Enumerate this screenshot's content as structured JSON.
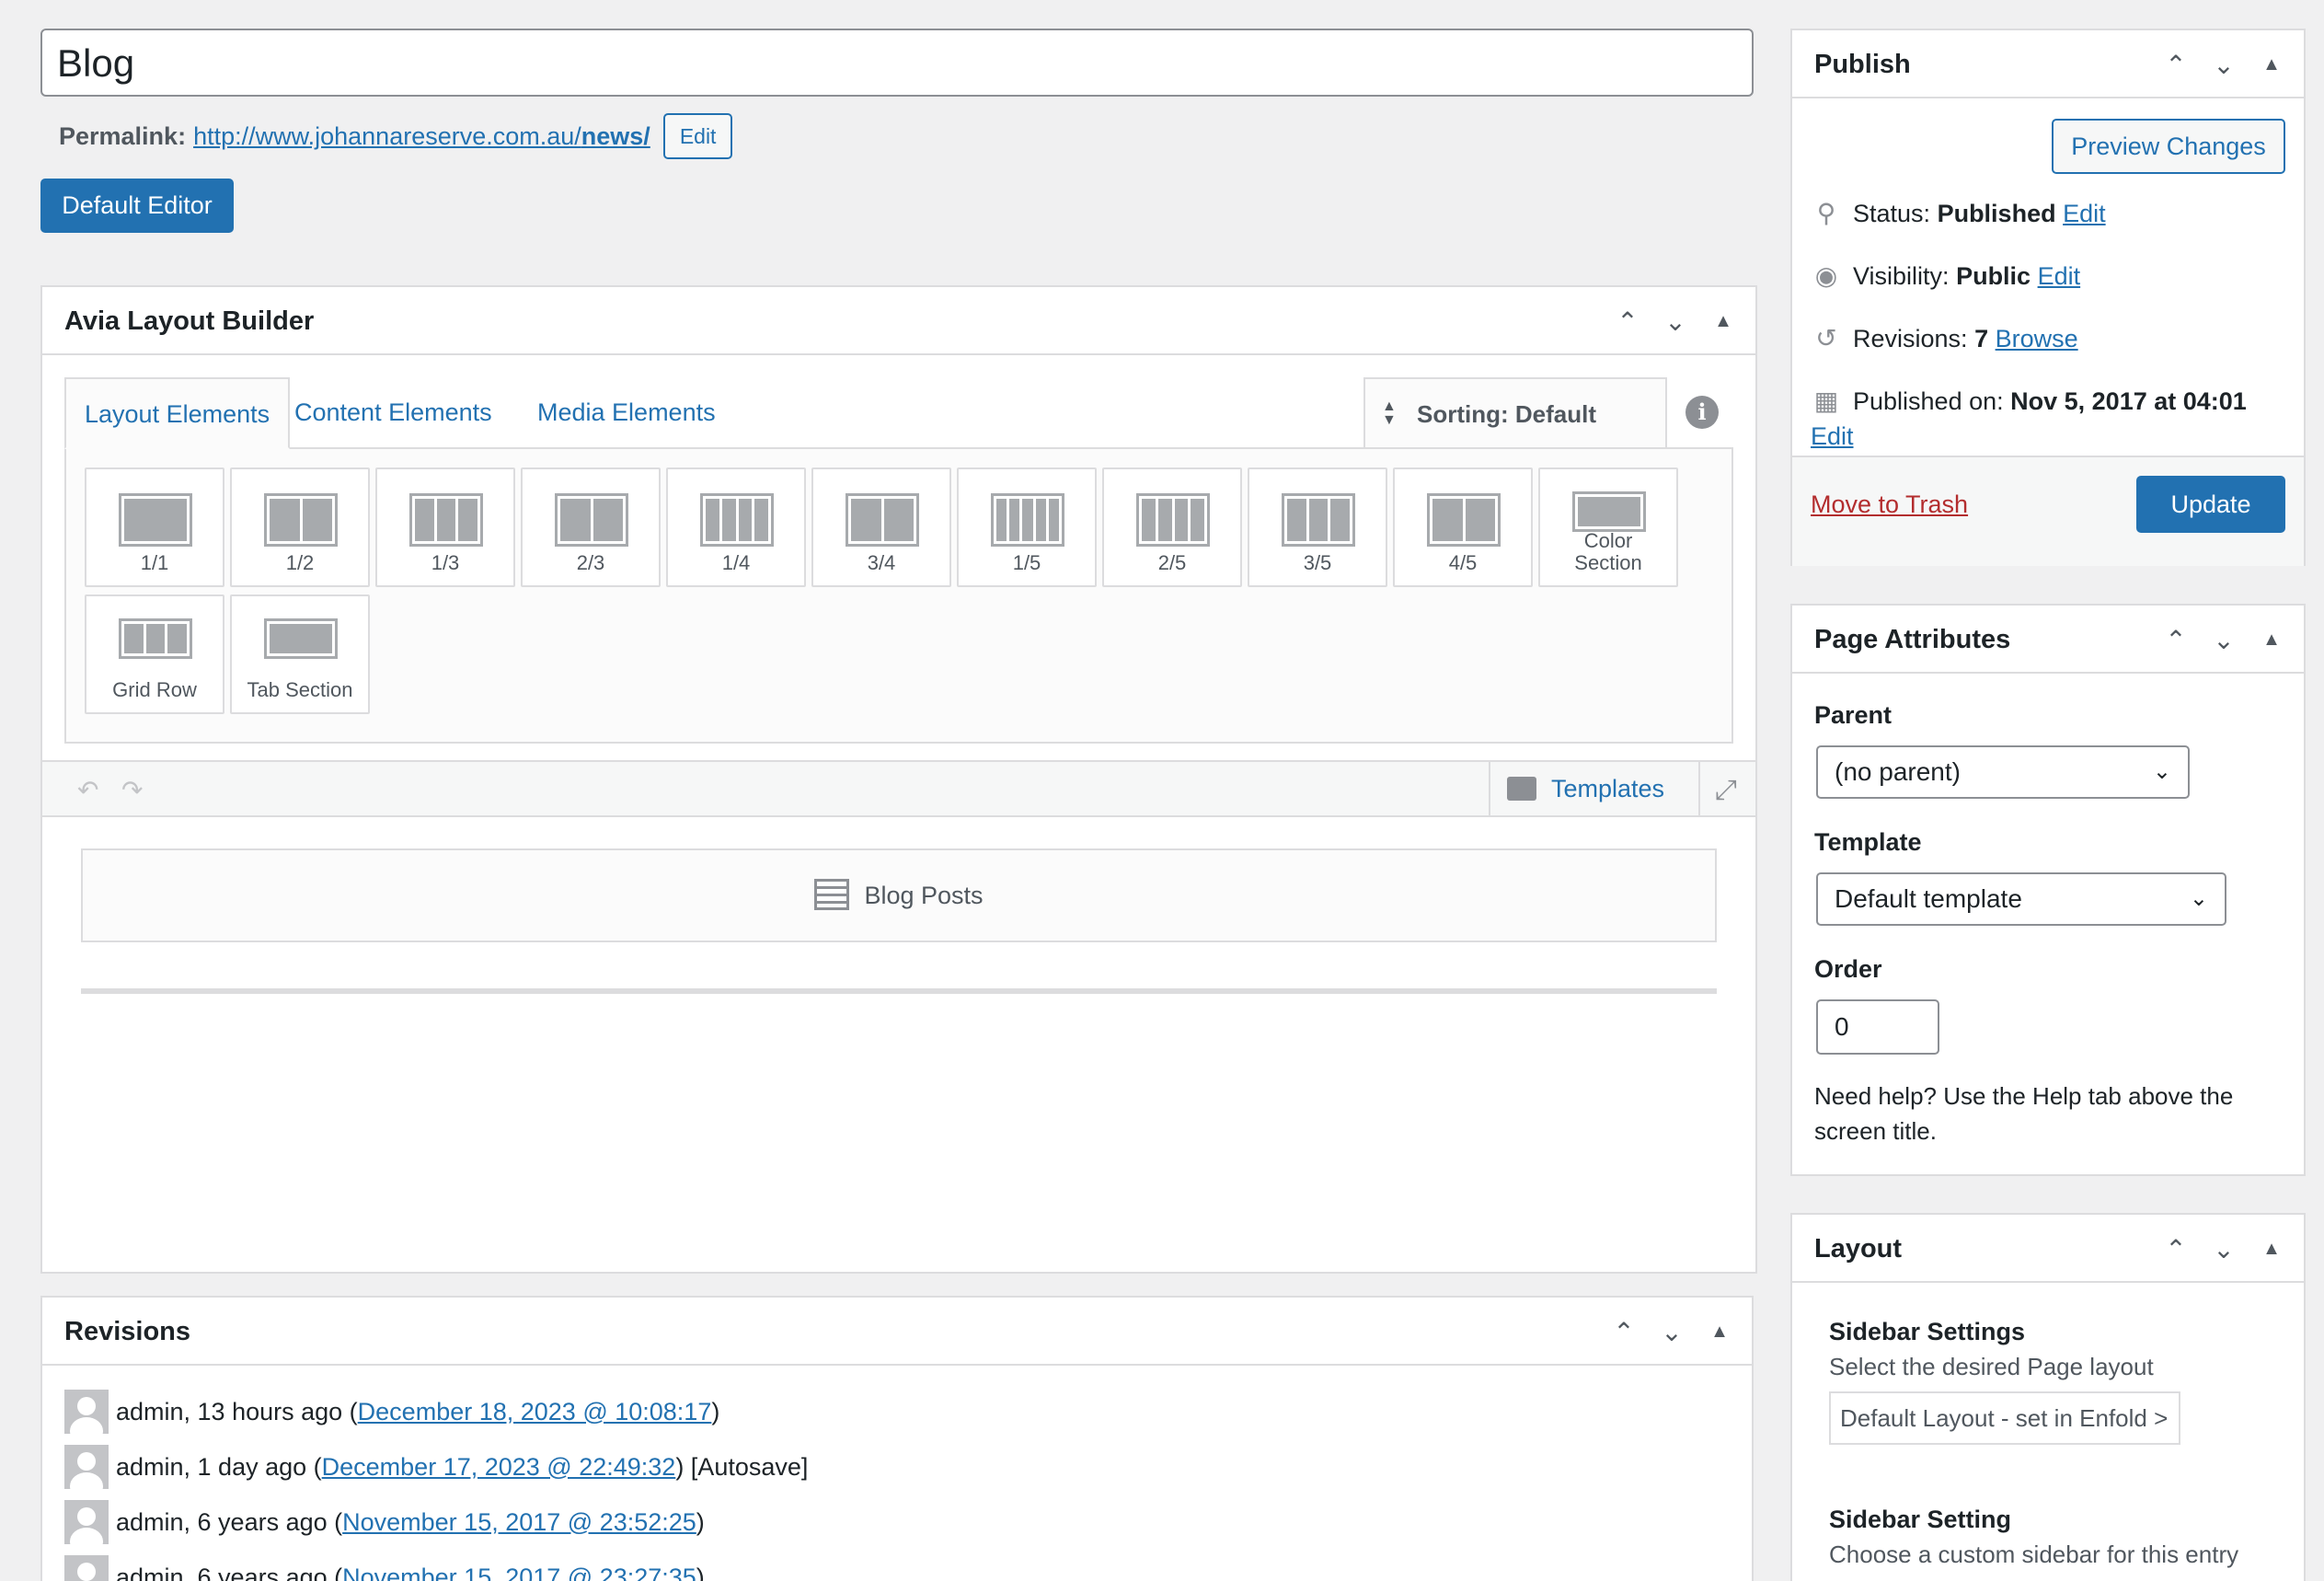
{
  "post": {
    "title": "Blog",
    "permalink_label": "Permalink:",
    "permalink_base": "http://www.johannareserve.com.au/",
    "permalink_slug": "news/",
    "permalink_edit": "Edit",
    "default_editor": "Default Editor"
  },
  "avia": {
    "title": "Avia Layout Builder",
    "tabs": [
      "Layout Elements",
      "Content Elements",
      "Media Elements"
    ],
    "sorting": "Sorting: Default",
    "elements": [
      {
        "label": "1/1",
        "cols": 1
      },
      {
        "label": "1/2",
        "cols": 2
      },
      {
        "label": "1/3",
        "cols": 3
      },
      {
        "label": "2/3",
        "cols": 2
      },
      {
        "label": "1/4",
        "cols": 4
      },
      {
        "label": "3/4",
        "cols": 2
      },
      {
        "label": "1/5",
        "cols": 5
      },
      {
        "label": "2/5",
        "cols": 4
      },
      {
        "label": "3/5",
        "cols": 3
      },
      {
        "label": "4/5",
        "cols": 2
      },
      {
        "label": "Color Section",
        "cols": 1
      },
      {
        "label": "Grid Row",
        "cols": 3
      },
      {
        "label": "Tab Section",
        "cols": 1
      }
    ],
    "templates": "Templates",
    "canvas_item": "Blog Posts"
  },
  "revisions": {
    "title": "Revisions",
    "rows": [
      {
        "prefix": "admin, 13 hours ago (",
        "link": "December 18, 2023 @ 10:08:17",
        "suffix": ")"
      },
      {
        "prefix": "admin, 1 day ago (",
        "link": "December 17, 2023 @ 22:49:32",
        "suffix": ") [Autosave]"
      },
      {
        "prefix": "admin, 6 years ago (",
        "link": "November 15, 2017 @ 23:52:25",
        "suffix": ")"
      },
      {
        "prefix": "admin, 6 years ago (",
        "link": "November 15, 2017 @ 23:27:35",
        "suffix": ")"
      }
    ]
  },
  "publish": {
    "title": "Publish",
    "preview": "Preview Changes",
    "status_label": "Status:",
    "status_value": "Published",
    "visibility_label": "Visibility:",
    "visibility_value": "Public",
    "revisions_label": "Revisions:",
    "revisions_value": "7",
    "browse": "Browse",
    "published_label": "Published on:",
    "published_value": "Nov 5, 2017 at 04:01",
    "edit": "Edit",
    "trash": "Move to Trash",
    "update": "Update"
  },
  "attributes": {
    "title": "Page Attributes",
    "parent_label": "Parent",
    "parent_value": "(no parent)",
    "template_label": "Template",
    "template_value": "Default template",
    "order_label": "Order",
    "order_value": "0",
    "help": "Need help? Use the Help tab above the screen title."
  },
  "layout": {
    "title": "Layout",
    "sidebar_settings_label": "Sidebar Settings",
    "sidebar_settings_desc": "Select the desired Page layout",
    "sidebar_settings_value": "Default Layout - set in Enfold >",
    "sidebar_setting_label": "Sidebar Setting",
    "sidebar_setting_desc": "Choose a custom sidebar for this entry"
  },
  "colors": {
    "accent": "#2271b1",
    "danger": "#b32d2e",
    "background": "#f0f0f1"
  }
}
